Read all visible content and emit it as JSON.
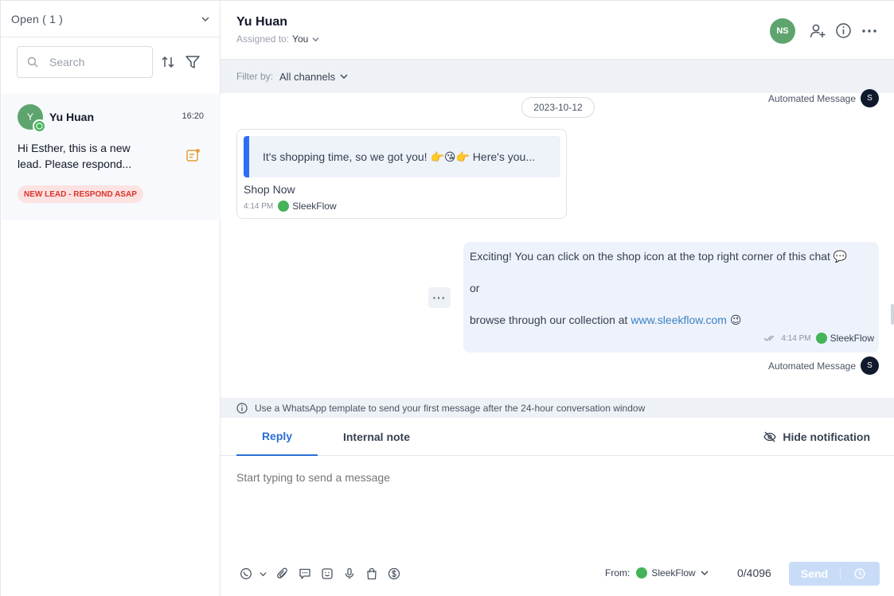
{
  "inbox": {
    "filter_label": "Open ( 1 )",
    "search_placeholder": "Search",
    "conversation": {
      "avatar_initial": "Y",
      "name": "Yu Huan",
      "time": "16:20",
      "preview_line1": "Hi Esther, this is a new",
      "preview_line2": "lead. Please respond...",
      "tag": "NEW LEAD - RESPOND ASAP"
    }
  },
  "header": {
    "contact_name": "Yu Huan",
    "assigned_label": "Assigned to:",
    "assigned_value": "You",
    "agent_initials": "NS"
  },
  "filter": {
    "label": "Filter by:",
    "value": "All channels"
  },
  "messages": {
    "date": "2023-10-12",
    "automated_label": "Automated Message",
    "badge_initial": "S",
    "card_quote": "It's shopping time, so we got you! 👉😘👉 Here's you...",
    "card_button": "Shop Now",
    "card_time": "4:14 PM",
    "card_channel": "SleekFlow",
    "bubble_line1": "Exciting! You can click on the shop icon at the top right corner of this chat 💬",
    "bubble_line2": "or",
    "bubble_line3_prefix": "browse through our collection at ",
    "bubble_link": "www.sleekflow.com",
    "bubble_emoji": " 😉",
    "bubble_time": "4:14 PM",
    "bubble_channel": "SleekFlow",
    "more_label": "···"
  },
  "notice": {
    "text": "Use a WhatsApp template to send your first message after the 24-hour conversation window"
  },
  "composer": {
    "tab_reply": "Reply",
    "tab_note": "Internal note",
    "hide_notification": "Hide notification",
    "placeholder": "Start typing to send a message",
    "from_label": "From:",
    "from_channel": "SleekFlow",
    "char_count": "0/4096",
    "send_label": "Send"
  },
  "colors": {
    "accent": "#2b6fd6",
    "whatsapp": "#45b35a",
    "avatar": "#5ea46e",
    "tag_bg": "#fde2e2",
    "tag_text": "#d9342b"
  }
}
